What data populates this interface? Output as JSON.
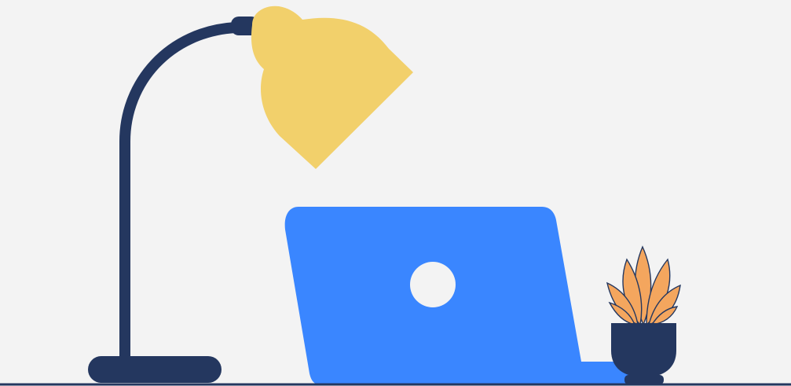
{
  "scene": {
    "background_color": "#f3f3f3",
    "colors": {
      "lamp_body": "#24375f",
      "lamp_shade": "#f2d06b",
      "laptop": "#3a86ff",
      "laptop_logo": "#f3f3f3",
      "pot": "#24375f",
      "leaves": "#f4a65e",
      "leaf_veins": "#24375f",
      "floor_line": "#24375f"
    },
    "objects": [
      {
        "name": "desk-lamp",
        "icon": "desk-lamp-icon"
      },
      {
        "name": "laptop",
        "icon": "laptop-icon"
      },
      {
        "name": "potted-plant",
        "icon": "plant-icon"
      }
    ]
  }
}
